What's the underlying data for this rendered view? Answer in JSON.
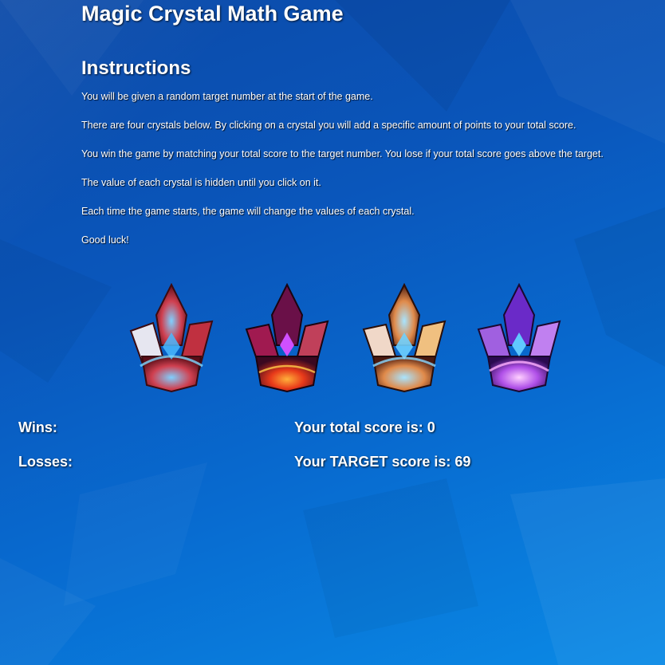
{
  "game": {
    "title": "Magic Crystal Math Game"
  },
  "instructions": {
    "heading": "Instructions",
    "lines": [
      "You will be given a random target number at the start of the game.",
      "There are four crystals below. By clicking on a crystal you will add a specific amount of points to your total score.",
      "You win the game by matching your total score to the target number. You lose if your total score goes above the target.",
      "The value of each crystal is hidden until you click on it.",
      "Each time the game starts, the game will change the values of each crystal.",
      "Good luck!"
    ]
  },
  "crystals": [
    {
      "icon": "red-blue-crystal-icon",
      "colors": {
        "main": "#b8242e",
        "glow": "#3aa0ff"
      }
    },
    {
      "icon": "purple-red-crystal-icon",
      "colors": {
        "main": "#8a1460",
        "glow": "#ff4a1a"
      }
    },
    {
      "icon": "orange-blue-crystal-icon",
      "colors": {
        "main": "#d8763a",
        "glow": "#6fc4ff"
      }
    },
    {
      "icon": "violet-crystal-icon",
      "colors": {
        "main": "#7a3ad8",
        "glow": "#f080ff"
      }
    }
  ],
  "stats": {
    "wins_label": "Wins:",
    "losses_label": "Losses:",
    "total_score_label": "Your total score is: 0",
    "target_score_label": "Your TARGET score is: 69"
  }
}
